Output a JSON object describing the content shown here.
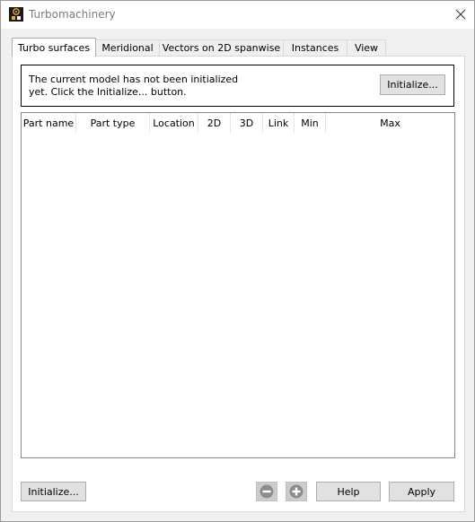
{
  "window": {
    "title": "Turbomachinery",
    "icon": "app-logo-icon",
    "close_icon": "close-icon"
  },
  "tabs": [
    {
      "label": "Turbo surfaces",
      "active": true
    },
    {
      "label": "Meridional",
      "active": false
    },
    {
      "label": "Vectors on 2D spanwise",
      "active": false
    },
    {
      "label": "Instances",
      "active": false
    },
    {
      "label": "View",
      "active": false
    }
  ],
  "message": {
    "line1": "The current model has not been initialized",
    "line2": "yet. Click the Initialize... button.",
    "initialize_label": "Initialize..."
  },
  "table": {
    "columns": [
      "Part name",
      "Part type",
      "Location",
      "2D",
      "3D",
      "Link",
      "Min",
      "Max"
    ],
    "rows": []
  },
  "footer": {
    "initialize_label": "Initialize...",
    "remove_icon": "minus-circle-icon",
    "add_icon": "plus-circle-icon",
    "help_label": "Help",
    "apply_label": "Apply"
  },
  "colors": {
    "border": "#adadad",
    "button_bg": "#e1e1e1",
    "disabled_icon": "#cccccc"
  }
}
